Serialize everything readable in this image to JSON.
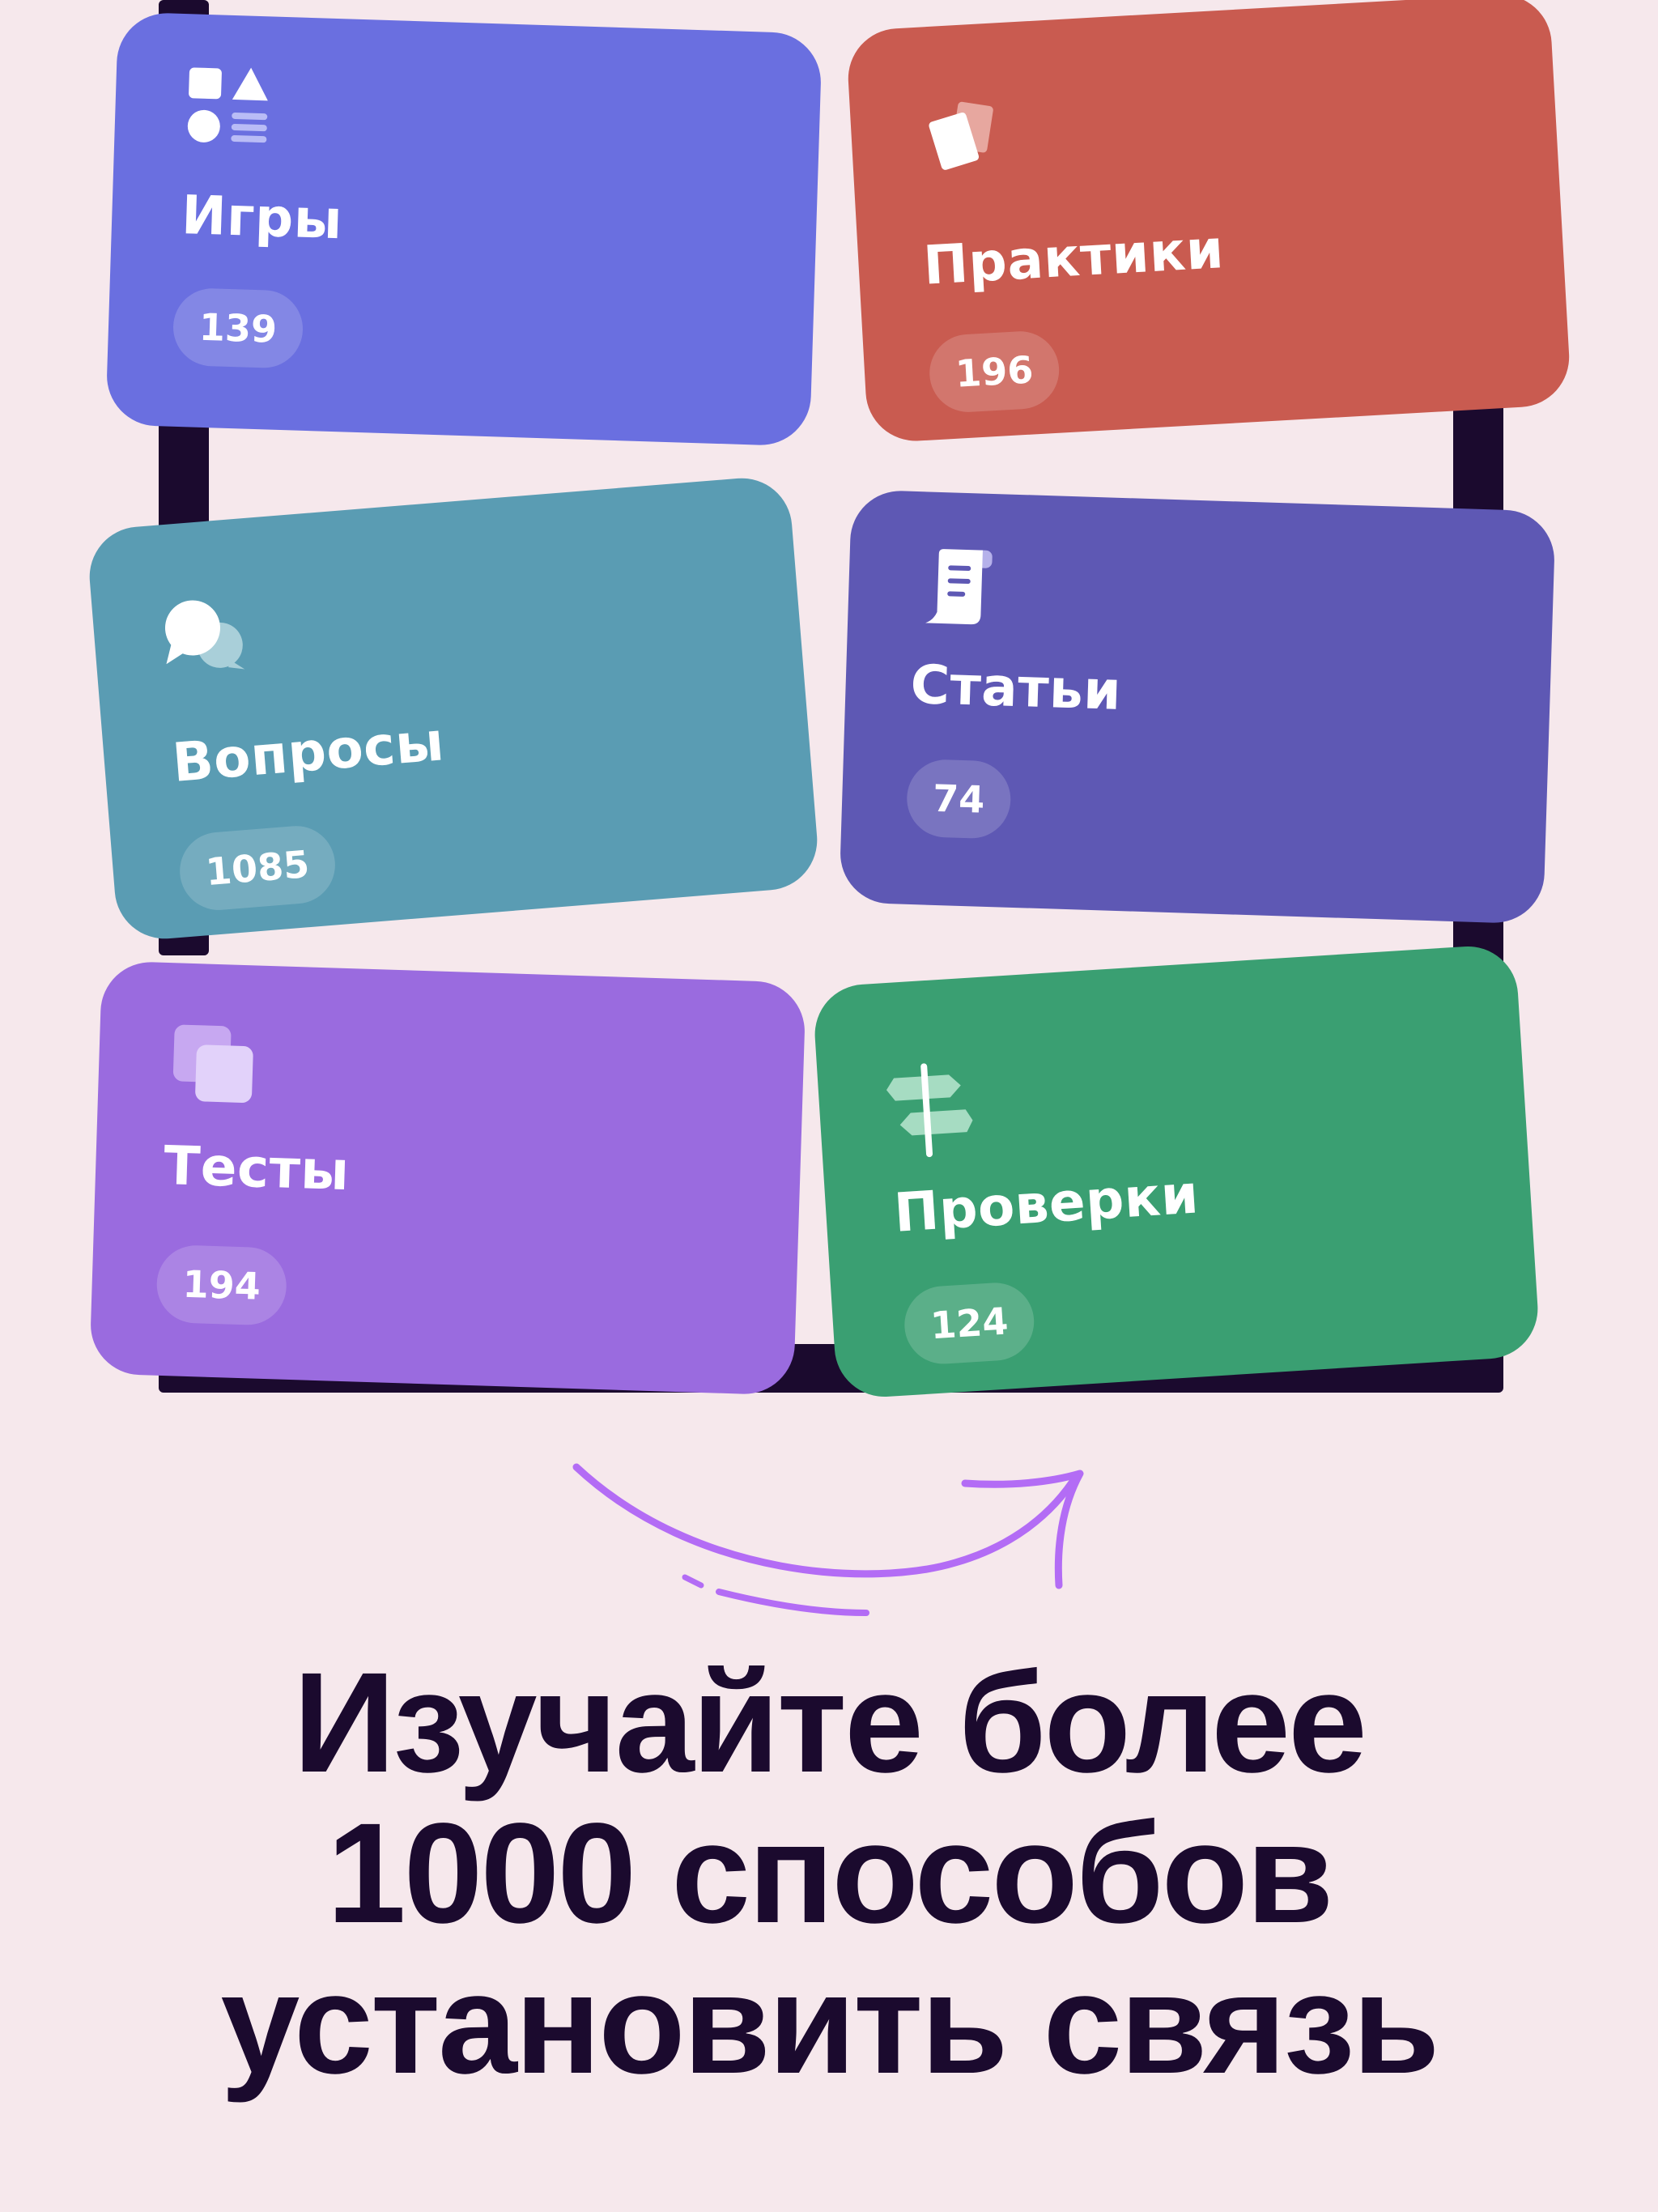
{
  "categories": [
    {
      "title": "Игры",
      "count": "139",
      "color": "#6a6fe0",
      "icon": "shapes-icon"
    },
    {
      "title": "Практики",
      "count": "196",
      "color": "#c95b50",
      "icon": "cards-icon"
    },
    {
      "title": "Вопросы",
      "count": "1085",
      "color": "#5a9cb3",
      "icon": "chat-bubbles-icon"
    },
    {
      "title": "Статьи",
      "count": "74",
      "color": "#5e58b4",
      "icon": "scroll-icon"
    },
    {
      "title": "Тесты",
      "count": "194",
      "color": "#9a6bdf",
      "icon": "layers-icon"
    },
    {
      "title": "Проверки",
      "count": "124",
      "color": "#3a9f72",
      "icon": "signpost-icon"
    }
  ],
  "headline": {
    "line1": "Изучайте более",
    "line2": "1000 способов",
    "line3": "установить связь"
  },
  "colors": {
    "background": "#f6e8ec",
    "frame": "#1b0a2e",
    "arrow": "#b36cf5",
    "text": "#1b0a2e"
  }
}
